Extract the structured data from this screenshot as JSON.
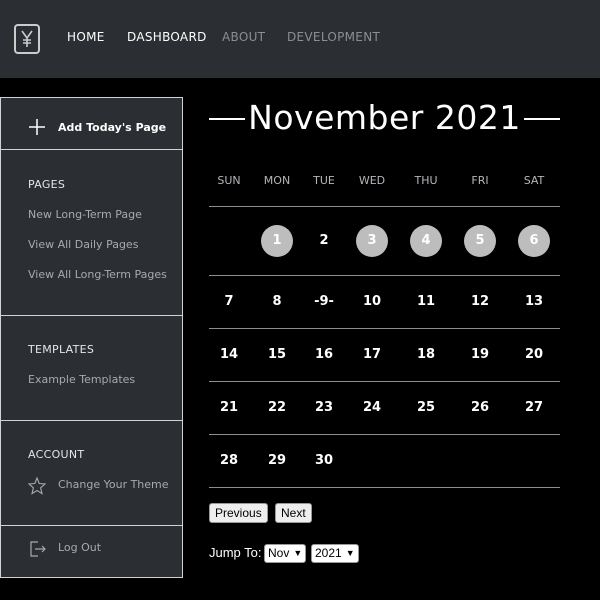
{
  "nav": {
    "items": [
      {
        "label": "HOME",
        "active": true
      },
      {
        "label": "DASHBOARD",
        "active": true
      },
      {
        "label": "ABOUT",
        "active": false
      },
      {
        "label": "DEVELOPMENT",
        "active": false
      }
    ]
  },
  "sidebar": {
    "add_label": "Add Today's Page",
    "pages": {
      "heading": "PAGES",
      "links": [
        "New Long-Term Page",
        "View All Daily Pages",
        "View All Long-Term Pages"
      ]
    },
    "templates": {
      "heading": "TEMPLATES",
      "links": [
        "Example Templates"
      ]
    },
    "account": {
      "heading": "ACCOUNT",
      "links": [
        "Change Your Theme"
      ]
    },
    "logout_label": "Log Out"
  },
  "calendar": {
    "title": "November 2021",
    "weekdays": [
      "SUN",
      "MON",
      "TUE",
      "WED",
      "THU",
      "FRI",
      "SAT"
    ],
    "today_label": "-9-",
    "highlighted_days": [
      1,
      3,
      4,
      5,
      6
    ],
    "weeks": [
      [
        "",
        "1",
        "2",
        "3",
        "4",
        "5",
        "6"
      ],
      [
        "7",
        "8",
        "-9-",
        "10",
        "11",
        "12",
        "13"
      ],
      [
        "14",
        "15",
        "16",
        "17",
        "18",
        "19",
        "20"
      ],
      [
        "21",
        "22",
        "23",
        "24",
        "25",
        "26",
        "27"
      ],
      [
        "28",
        "29",
        "30",
        "",
        "",
        "",
        ""
      ]
    ]
  },
  "controls": {
    "previous_label": "Previous",
    "next_label": "Next",
    "jump_label": "Jump To:",
    "month_value": "Nov",
    "year_value": "2021"
  }
}
